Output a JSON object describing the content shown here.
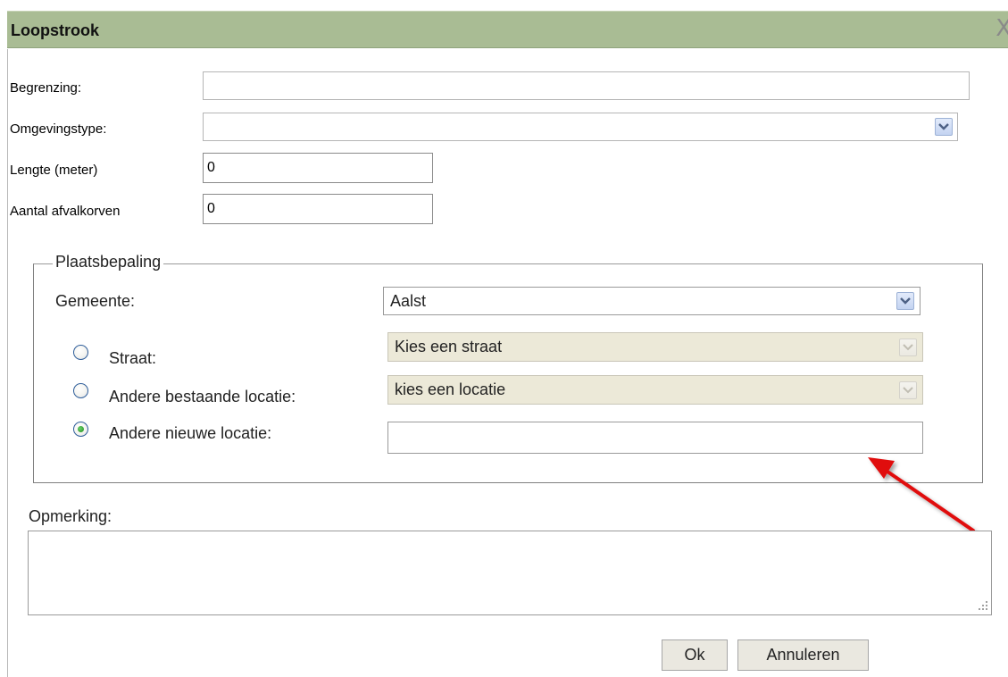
{
  "dialog": {
    "title": "Loopstrook",
    "close_glyph": "X"
  },
  "form": {
    "begrenzing_label": "Begrenzing:",
    "begrenzing_value": "",
    "omgevingstype_label": "Omgevingstype:",
    "omgevingstype_value": "",
    "lengte_label": "Lengte (meter)",
    "lengte_value": "0",
    "afvalkorven_label": "Aantal afvalkorven",
    "afvalkorven_value": "0"
  },
  "plaatsbepaling": {
    "legend": "Plaatsbepaling",
    "gemeente_label": "Gemeente:",
    "gemeente_value": "Aalst",
    "straat_label": "Straat:",
    "straat_value": "Kies een straat",
    "straat_selected": false,
    "bestaande_label": "Andere bestaande locatie:",
    "bestaande_value": "kies een locatie",
    "bestaande_selected": false,
    "nieuwe_label": "Andere nieuwe locatie:",
    "nieuwe_value": "",
    "nieuwe_selected": true
  },
  "opmerking": {
    "label": "Opmerking:",
    "value": ""
  },
  "buttons": {
    "ok": "Ok",
    "cancel": "Annuleren"
  },
  "colors": {
    "titlebar": "#a9bc94",
    "annotation_arrow": "#e01010"
  }
}
